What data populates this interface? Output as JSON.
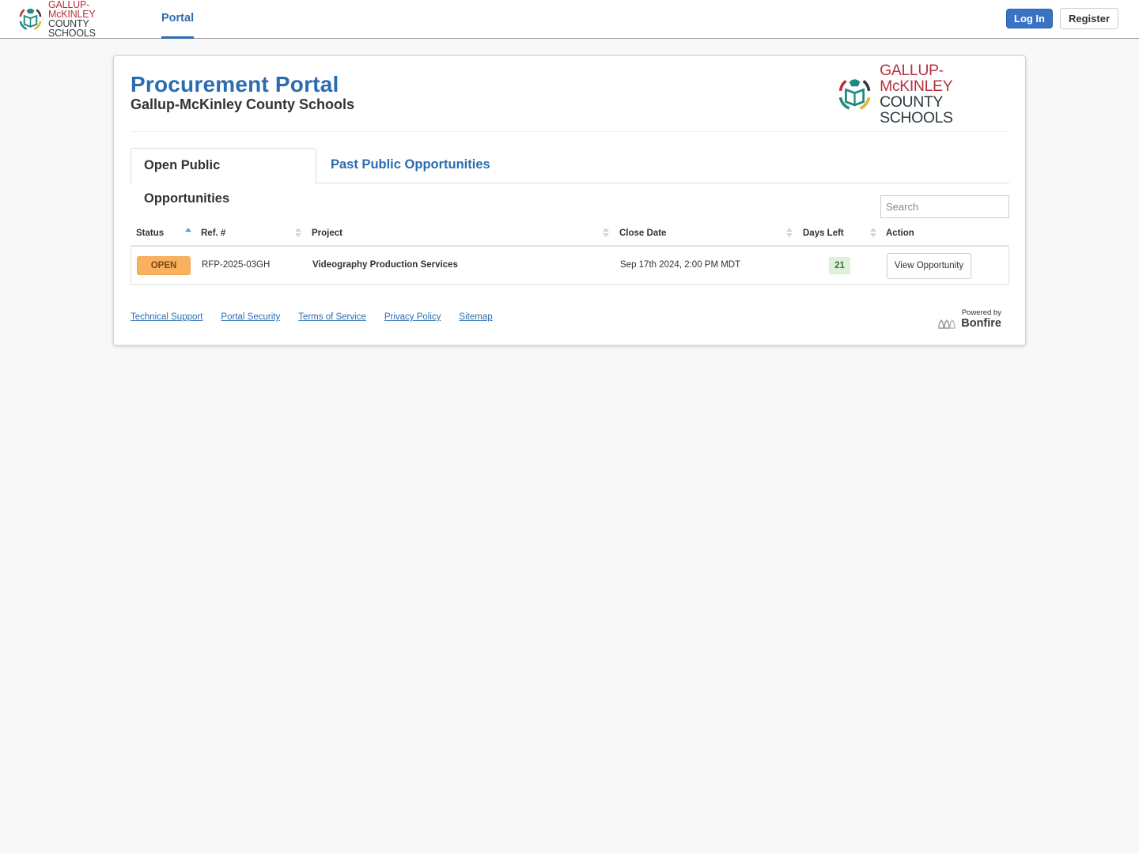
{
  "topbar": {
    "brand": {
      "line1": "GALLUP-McKINLEY",
      "line2": "COUNTY SCHOOLS"
    },
    "nav": [
      {
        "label": "Portal",
        "active": true
      }
    ],
    "login_label": "Log In",
    "register_label": "Register"
  },
  "header": {
    "title": "Procurement Portal",
    "subtitle": "Gallup-McKinley County Schools",
    "logo": {
      "line1": "GALLUP-McKINLEY",
      "line2": "COUNTY SCHOOLS"
    }
  },
  "tabs": [
    {
      "label": "Open Public Opportunities",
      "active": true
    },
    {
      "label": "Past Public Opportunities",
      "active": false
    }
  ],
  "search": {
    "placeholder": "Search",
    "value": ""
  },
  "table": {
    "columns": [
      {
        "label": "Status",
        "sort": "asc"
      },
      {
        "label": "Ref. #",
        "sort": "none"
      },
      {
        "label": "Project",
        "sort": "none"
      },
      {
        "label": "Close Date",
        "sort": "none"
      },
      {
        "label": "Days Left",
        "sort": "none"
      },
      {
        "label": "Action",
        "sort": null
      }
    ],
    "rows": [
      {
        "status": "OPEN",
        "ref": "RFP-2025-03GH",
        "project": "Videography Production Services",
        "close_date": "Sep 17th 2024, 2:00 PM MDT",
        "days_left": "21",
        "action": "View Opportunity"
      }
    ]
  },
  "footer": {
    "links": [
      "Technical Support",
      "Portal Security",
      "Terms of Service",
      "Privacy Policy",
      "Sitemap"
    ],
    "powered_by": "Powered by",
    "powered_name": "Bonfire"
  },
  "colors": {
    "brand_blue": "#2b6cb0",
    "login_bg": "#3a73c4",
    "status_open": "#f9b05f",
    "days_left_bg": "#dff0d8",
    "logo_red": "#b5313f",
    "logo_teal": "#1f8a80"
  }
}
